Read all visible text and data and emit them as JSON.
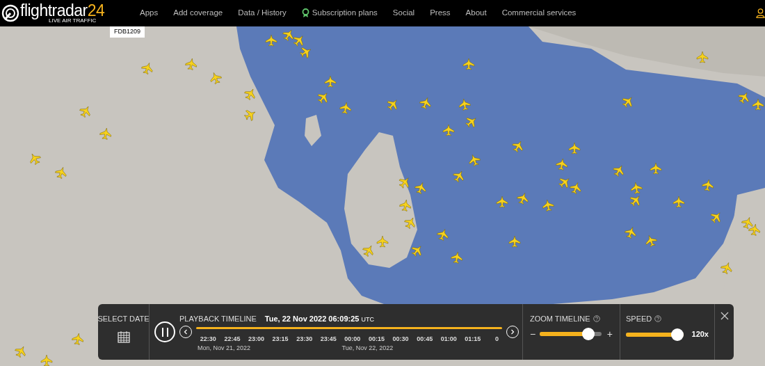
{
  "header": {
    "logo_text": "flightradar",
    "logo_number": "24",
    "tagline": "LIVE AIR TRAFFIC",
    "nav": [
      {
        "label": "Apps",
        "kind": "plain"
      },
      {
        "label": "Add coverage",
        "kind": "plain"
      },
      {
        "label": "Data / History",
        "kind": "plain"
      },
      {
        "label": "Subscription plans",
        "kind": "award"
      },
      {
        "label": "Social",
        "kind": "plain"
      },
      {
        "label": "Press",
        "kind": "plain"
      },
      {
        "label": "About",
        "kind": "plain"
      },
      {
        "label": "Commercial services",
        "kind": "plain"
      }
    ]
  },
  "map": {
    "flight_label": "FDB1209"
  },
  "playback": {
    "select_date": "SELECT DATE",
    "title": "PLAYBACK TIMELINE",
    "datetime": "Tue, 22 Nov 2022 06:09:25",
    "timezone": "UTC",
    "ticks": [
      {
        "time": "22:30",
        "date": "Mon, Nov 21, 2022"
      },
      {
        "time": "22:45"
      },
      {
        "time": "23:00"
      },
      {
        "time": "23:15"
      },
      {
        "time": "23:30"
      },
      {
        "time": "23:45"
      },
      {
        "time": "00:00",
        "date": "Tue, Nov 22, 2022"
      },
      {
        "time": "00:15"
      },
      {
        "time": "00:30"
      },
      {
        "time": "00:45"
      },
      {
        "time": "01:00"
      },
      {
        "time": "01:15"
      },
      {
        "time": "0"
      }
    ],
    "zoom": {
      "title": "ZOOM TIMELINE",
      "minus": "−",
      "plus": "+",
      "level": 0.86
    },
    "speed": {
      "title": "SPEED",
      "level": 1,
      "reading": "120x"
    }
  }
}
